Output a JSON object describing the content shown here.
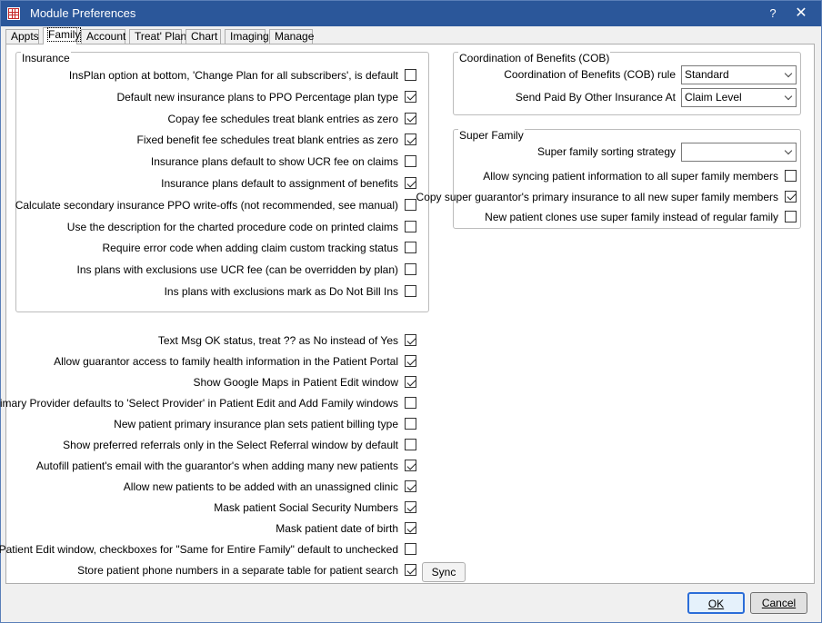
{
  "window": {
    "title": "Module Preferences",
    "help_label": "?",
    "close_label": "✕"
  },
  "tabs": [
    "Appts",
    "Family",
    "Account",
    "Treat' Plan",
    "Chart",
    "Imaging",
    "Manage"
  ],
  "selected_tab": "Family",
  "insurance": {
    "title": "Insurance",
    "items": [
      {
        "label": "InsPlan option at bottom, 'Change Plan for all subscribers', is default",
        "checked": false
      },
      {
        "label": "Default new insurance plans to PPO Percentage plan type",
        "checked": true
      },
      {
        "label": "Copay fee schedules treat blank entries as zero",
        "checked": true
      },
      {
        "label": "Fixed benefit fee schedules treat blank entries as zero",
        "checked": true
      },
      {
        "label": "Insurance plans default to show UCR fee on claims",
        "checked": false
      },
      {
        "label": "Insurance plans default to assignment of benefits",
        "checked": true
      },
      {
        "label": "Calculate secondary insurance PPO write-offs (not recommended, see manual)",
        "checked": false
      },
      {
        "label": "Use the description for the charted procedure code on printed claims",
        "checked": false
      },
      {
        "label": "Require error code when adding claim custom tracking status",
        "checked": false
      },
      {
        "label": "Ins plans with exclusions use UCR fee (can be overridden by plan)",
        "checked": false
      },
      {
        "label": "Ins plans with exclusions mark as Do Not Bill Ins",
        "checked": false
      }
    ]
  },
  "general": {
    "items": [
      {
        "label": "Text Msg OK status, treat ?? as No instead of Yes",
        "checked": true
      },
      {
        "label": "Allow guarantor access to family health information in the Patient Portal",
        "checked": true
      },
      {
        "label": "Show Google Maps in Patient Edit window",
        "checked": true
      },
      {
        "label": "Primary Provider defaults to 'Select Provider' in Patient Edit and Add Family windows",
        "checked": false
      },
      {
        "label": "New patient primary insurance plan sets patient billing type",
        "checked": false
      },
      {
        "label": "Show preferred referrals only in the Select Referral window by default",
        "checked": false
      },
      {
        "label": "Autofill patient's email with the guarantor's when adding many new patients",
        "checked": true
      },
      {
        "label": "Allow new patients to be added with an unassigned clinic",
        "checked": true
      },
      {
        "label": "Mask patient Social Security Numbers",
        "checked": true
      },
      {
        "label": "Mask patient date of birth",
        "checked": true
      },
      {
        "label": "In Patient Edit window, checkboxes for \"Same for Entire Family\" default to unchecked",
        "checked": false
      },
      {
        "label": "Store patient phone numbers in a separate table for patient search",
        "checked": true
      }
    ],
    "sync_label": "Sync"
  },
  "cob": {
    "title": "Coordination of Benefits (COB)",
    "rule_label": "Coordination of Benefits (COB) rule",
    "rule_value": "Standard",
    "paid_label": "Send Paid By Other Insurance At",
    "paid_value": "Claim Level"
  },
  "super_family": {
    "title": "Super Family",
    "strategy_label": "Super family sorting strategy",
    "strategy_value": "",
    "items": [
      {
        "label": "Allow syncing patient information to all super family members",
        "checked": false
      },
      {
        "label": "Copy super guarantor's primary insurance to all new super family members",
        "checked": true
      },
      {
        "label": "New patient clones use super family instead of regular family",
        "checked": false
      }
    ]
  },
  "footer": {
    "ok_label": "OK",
    "cancel_label": "Cancel"
  }
}
